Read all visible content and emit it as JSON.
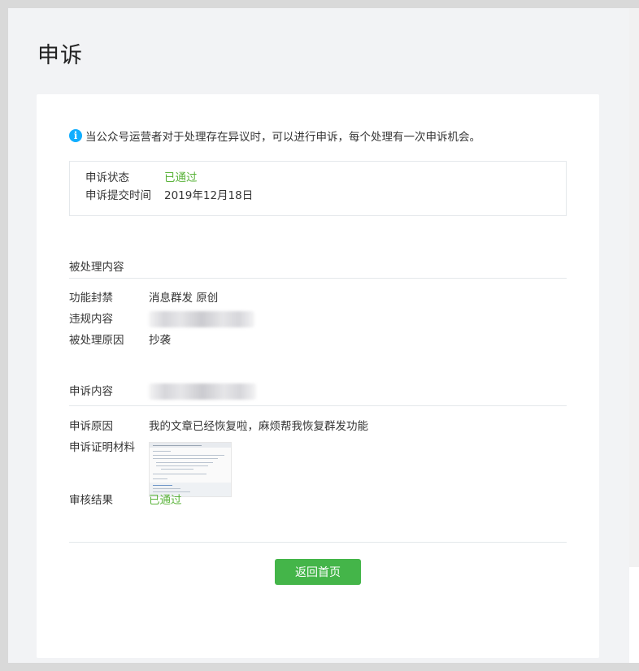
{
  "page": {
    "title": "申诉"
  },
  "notice": {
    "icon": "info-icon",
    "text": "当公众号运营者对于处理存在异议时，可以进行申诉，每个处理有一次申诉机会。"
  },
  "status": {
    "state_label": "申诉状态",
    "state_value": "已通过",
    "time_label": "申诉提交时间",
    "time_value": "2019年12月18日"
  },
  "processed": {
    "title": "被处理内容",
    "function_label": "功能封禁",
    "function_value": "消息群发 原创",
    "violation_label": "违规内容",
    "reason_label": "被处理原因",
    "reason_value": "抄袭"
  },
  "appeal": {
    "title": "申诉内容",
    "reason_label": "申诉原因",
    "reason_value": "我的文章已经恢复啦，麻烦帮我恢复群发功能",
    "evidence_label": "申诉证明材料",
    "result_label": "审核结果",
    "result_value": "已通过"
  },
  "actions": {
    "back_label": "返回首页"
  },
  "colors": {
    "accent_green": "#44b549",
    "status_green": "#5ab33a",
    "info_blue": "#10aeff"
  }
}
